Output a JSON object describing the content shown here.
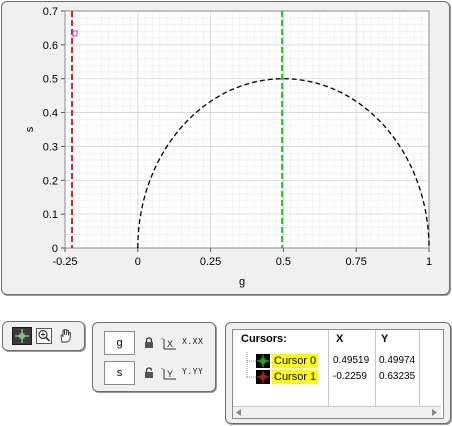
{
  "chart_data": {
    "type": "line",
    "xlabel": "g",
    "ylabel": "s",
    "xlim": [
      -0.25,
      1
    ],
    "ylim": [
      0,
      0.7
    ],
    "x_ticks": [
      "-0.25",
      "0",
      "0.25",
      "0.5",
      "0.75",
      "1"
    ],
    "y_ticks": [
      "0",
      "0.1",
      "0.2",
      "0.3",
      "0.4",
      "0.5",
      "0.6",
      "0.7"
    ],
    "grid": true,
    "series": [
      {
        "style": "dashed",
        "color": "#000000",
        "shape": "semicircle",
        "center": [
          0.5,
          0
        ],
        "radius": 0.5
      }
    ],
    "cursors": [
      {
        "color": "#22cc22",
        "x": 0.49519,
        "y": 0.49974
      },
      {
        "color": "#dd2222",
        "x": -0.2259,
        "y": 0.63235
      }
    ]
  },
  "tools": {
    "items": [
      {
        "icon": "cursor-move-icon",
        "active": true
      },
      {
        "icon": "zoom-icon",
        "active": false
      },
      {
        "icon": "pan-hand-icon",
        "active": false
      }
    ]
  },
  "scales": {
    "x_name": "g",
    "y_name": "s",
    "x_format_label": "X.XX",
    "y_format_label": "Y.YY",
    "x_autoscale_label": "X",
    "y_autoscale_label": "Y"
  },
  "cursor_legend": {
    "header_name": "Cursors:",
    "header_x": "X",
    "header_y": "Y",
    "rows": [
      {
        "name": "Cursor 0",
        "x": "0.49519",
        "y": "0.49974",
        "color": "#22cc22"
      },
      {
        "name": "Cursor 1",
        "x": "-0.2259",
        "y": "0.63235",
        "color": "#dd2222"
      }
    ]
  }
}
